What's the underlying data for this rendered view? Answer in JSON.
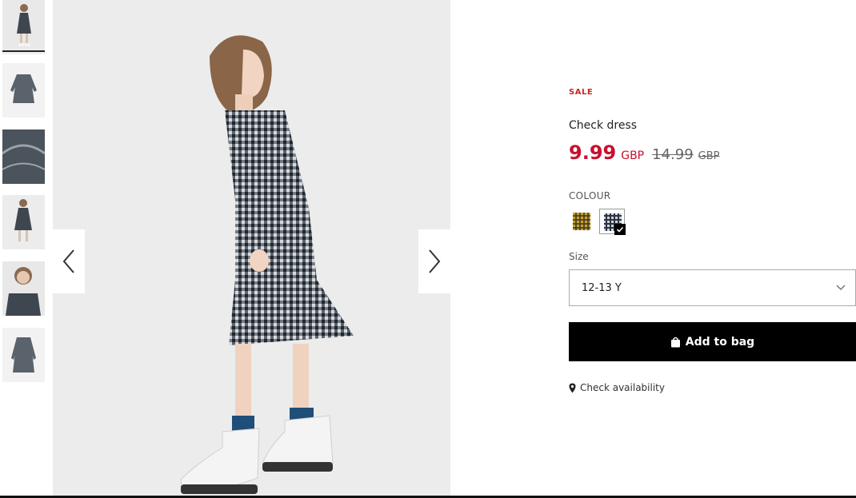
{
  "product": {
    "sale_label": "SALE",
    "title": "Check dress",
    "price_now": "9.99",
    "price_now_currency": "GBP",
    "price_old": "14.99",
    "price_old_currency": "GBP"
  },
  "colour": {
    "label": "COLOUR",
    "options": [
      {
        "name": "yellow-check",
        "color": "#c9a227"
      },
      {
        "name": "navy-check",
        "color": "#2b3440",
        "selected": true
      }
    ]
  },
  "size": {
    "label": "Size",
    "selected": "12-13 Y"
  },
  "actions": {
    "add_to_bag": "Add to bag",
    "check_availability": "Check availability"
  },
  "gallery": {
    "thumbnail_count": 6,
    "active_index": 0
  },
  "icons": [
    "chevron-left-icon",
    "chevron-right-icon",
    "chevron-down-icon",
    "bag-icon",
    "location-pin-icon",
    "checkmark-icon"
  ],
  "colors": {
    "sale": "#c62828",
    "price": "#c8102e",
    "button": "#000000"
  }
}
